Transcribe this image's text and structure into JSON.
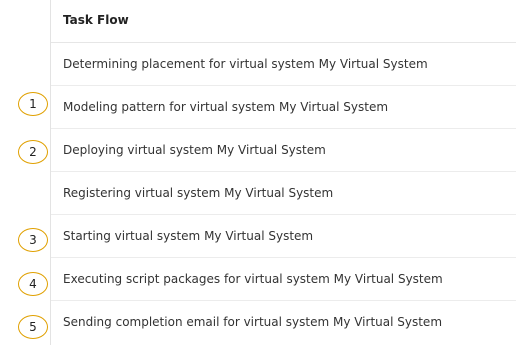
{
  "header": {
    "title": "Task Flow"
  },
  "tasks": [
    {
      "label": "Determining placement for virtual system My Virtual System",
      "step": ""
    },
    {
      "label": "Modeling pattern for virtual system My Virtual System",
      "step": "1"
    },
    {
      "label": "Deploying virtual system My Virtual System",
      "step": "2"
    },
    {
      "label": "Registering virtual system My Virtual System",
      "step": ""
    },
    {
      "label": "Starting virtual system My Virtual System",
      "step": "3"
    },
    {
      "label": "Executing script packages for virtual system My Virtual System",
      "step": "4"
    },
    {
      "label": "Sending completion email for virtual system My Virtual System",
      "step": "5"
    }
  ],
  "colors": {
    "marker_border": "#e0a000",
    "row_divider": "#ececec",
    "text": "#333333"
  }
}
